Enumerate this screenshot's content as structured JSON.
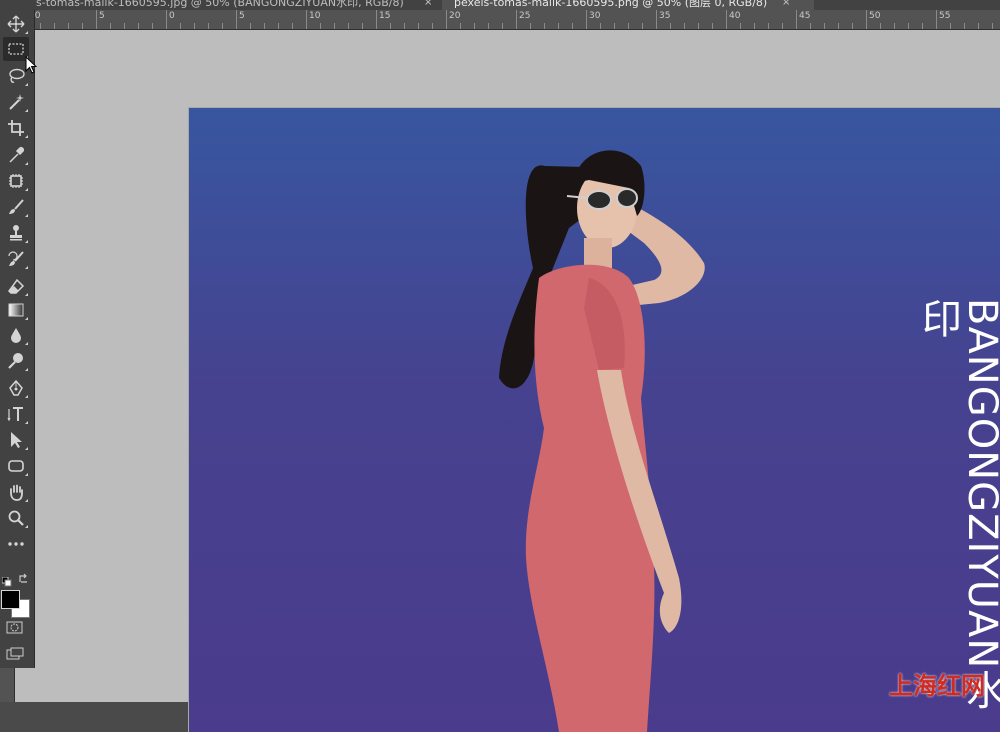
{
  "tabs": [
    {
      "label": "s-tomas-malik-1660595.jpg @ 50% (BANGONGZIYUAN水印, RGB/8)",
      "active": false
    },
    {
      "label": "pexels-tomas-malik-1660595.png @ 50% (图层 0, RGB/8)",
      "active": true
    }
  ],
  "tab_close_glyph": "×",
  "ruler": {
    "labels": [
      "10",
      "5",
      "0",
      "5",
      "10",
      "15",
      "20",
      "25",
      "30",
      "35",
      "40",
      "45",
      "50",
      "55"
    ]
  },
  "toolbar": {
    "tools": [
      {
        "name": "move-tool",
        "icon": "move-icon"
      },
      {
        "name": "marquee-tool",
        "icon": "rectangle-marquee-icon",
        "active": true
      },
      {
        "name": "lasso-tool",
        "icon": "lasso-icon"
      },
      {
        "name": "magic-wand-tool",
        "icon": "magic-wand-icon"
      },
      {
        "name": "crop-tool",
        "icon": "crop-icon"
      },
      {
        "name": "eyedropper-tool",
        "icon": "eyedropper-icon"
      },
      {
        "name": "patch-tool",
        "icon": "patch-icon"
      },
      {
        "name": "brush-tool",
        "icon": "brush-icon"
      },
      {
        "name": "stamp-tool",
        "icon": "clone-stamp-icon"
      },
      {
        "name": "history-brush-tool",
        "icon": "history-brush-icon"
      },
      {
        "name": "eraser-tool",
        "icon": "eraser-icon"
      },
      {
        "name": "gradient-tool",
        "icon": "gradient-icon"
      },
      {
        "name": "blur-tool",
        "icon": "blur-drop-icon"
      },
      {
        "name": "dodge-tool",
        "icon": "dodge-icon"
      },
      {
        "name": "pen-tool",
        "icon": "pen-icon"
      },
      {
        "name": "type-tool",
        "icon": "vertical-type-icon"
      },
      {
        "name": "path-selection-tool",
        "icon": "arrow-icon"
      },
      {
        "name": "shape-tool",
        "icon": "rounded-rectangle-icon"
      },
      {
        "name": "hand-tool",
        "icon": "hand-icon"
      },
      {
        "name": "zoom-tool",
        "icon": "zoom-icon"
      },
      {
        "name": "more-tools",
        "icon": "ellipsis-icon"
      }
    ],
    "foreground_color": "#000000",
    "background_color": "#ffffff"
  },
  "canvas": {
    "watermark_text": "BANGONGZIYUAN水印",
    "gradient_top": "#3856a0",
    "gradient_bottom": "#4b3b8c",
    "dress_color": "#d0686e"
  },
  "site_watermark": "上海红网"
}
